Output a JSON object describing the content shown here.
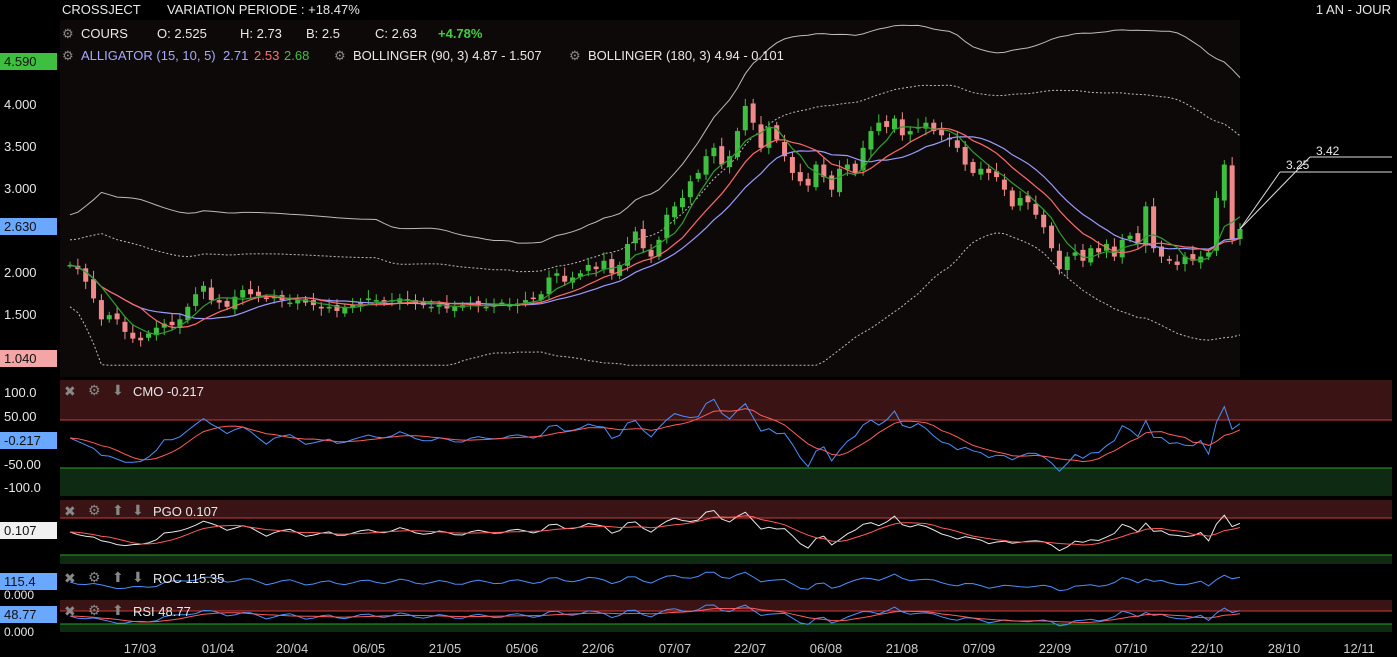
{
  "header": {
    "ticker": "CROSSJECT",
    "variation": "VARIATION PERIODE : +18.47%",
    "period": "1 AN - JOUR",
    "cours_label": "COURS",
    "open": "O: 2.525",
    "high": "H: 2.73",
    "low": "B: 2.5",
    "close": "C: 2.63",
    "change": "+4.78%"
  },
  "indicators": {
    "alligator_label": "ALLIGATOR (15, 10, 5)",
    "alligator_v1": "2.71",
    "alligator_v2": "2.53",
    "alligator_v3": "2.68",
    "boll1": "BOLLINGER (90, 3) 4.87 - 1.507",
    "boll2": "BOLLINGER (180, 3) 4.94 - 0.101"
  },
  "colors": {
    "up": "#3fbf3f",
    "down": "#f08a8a",
    "alligator_jaw": "#9a9aff",
    "alligator_teeth": "#ff6a6a",
    "alligator_lips": "#2ea02e",
    "osc_line": "#4a90ff",
    "signal_line": "#ff5a5a"
  },
  "price_axis": {
    "labels": [
      "4.000",
      "3.500",
      "3.000",
      "2.500",
      "2.000",
      "1.500"
    ],
    "high_badge": "4.590",
    "last_badge": "2.630",
    "low_badge": "1.040",
    "annot_a": "3.42",
    "annot_b": "3.25"
  },
  "x_axis": [
    "17/03",
    "01/04",
    "20/04",
    "06/05",
    "21/05",
    "05/06",
    "22/06",
    "07/07",
    "22/07",
    "06/08",
    "21/08",
    "07/09",
    "22/09",
    "07/10",
    "22/10",
    "28/10",
    "12/11"
  ],
  "panels": {
    "cmo": {
      "label": "CMO -0.217",
      "badge": "-0.217",
      "axis": [
        "100.0",
        "50.00",
        "-50.00",
        "-100.0"
      ]
    },
    "pgo": {
      "label": "PGO 0.107",
      "badge": "0.107"
    },
    "roc": {
      "label": "ROC 115.35",
      "badge": "115.4",
      "axis": [
        "0.000"
      ]
    },
    "rsi": {
      "label": "RSI 48.77",
      "badge": "48.77",
      "axis": [
        "0.000"
      ]
    }
  },
  "chart_data": {
    "type": "candlestick",
    "ylim": [
      1.04,
      4.59
    ],
    "close": [
      2.2,
      2.15,
      2.0,
      1.8,
      1.55,
      1.6,
      1.55,
      1.4,
      1.32,
      1.3,
      1.38,
      1.45,
      1.5,
      1.48,
      1.55,
      1.7,
      1.85,
      1.95,
      1.78,
      1.75,
      1.7,
      1.82,
      1.9,
      1.85,
      1.83,
      1.8,
      1.82,
      1.78,
      1.75,
      1.78,
      1.75,
      1.72,
      1.68,
      1.7,
      1.65,
      1.7,
      1.72,
      1.75,
      1.8,
      1.78,
      1.75,
      1.78,
      1.8,
      1.77,
      1.74,
      1.72,
      1.7,
      1.72,
      1.68,
      1.7,
      1.72,
      1.74,
      1.72,
      1.7,
      1.73,
      1.75,
      1.72,
      1.74,
      1.78,
      1.8,
      1.85,
      2.05,
      2.1,
      2.0,
      2.05,
      2.1,
      2.2,
      2.15,
      2.25,
      2.1,
      2.2,
      2.45,
      2.6,
      2.4,
      2.3,
      2.5,
      2.8,
      2.9,
      3.0,
      3.2,
      3.3,
      3.5,
      3.6,
      3.4,
      3.5,
      3.8,
      4.1,
      3.9,
      3.6,
      3.85,
      3.7,
      3.5,
      3.3,
      3.2,
      3.15,
      3.4,
      3.25,
      3.1,
      3.35,
      3.4,
      3.3,
      3.6,
      3.8,
      3.9,
      3.85,
      3.95,
      3.75,
      3.8,
      3.85,
      3.9,
      3.8,
      3.75,
      3.7,
      3.6,
      3.4,
      3.3,
      3.35,
      3.3,
      3.25,
      3.1,
      2.9,
      3.0,
      2.95,
      2.8,
      2.65,
      2.4,
      2.15,
      2.3,
      2.35,
      2.25,
      2.4,
      2.35,
      2.45,
      2.3,
      2.5,
      2.55,
      2.45,
      2.9,
      2.4,
      2.3,
      2.25,
      2.2,
      2.3,
      2.25,
      2.3,
      2.35,
      3.0,
      3.4,
      2.5,
      2.63
    ]
  }
}
